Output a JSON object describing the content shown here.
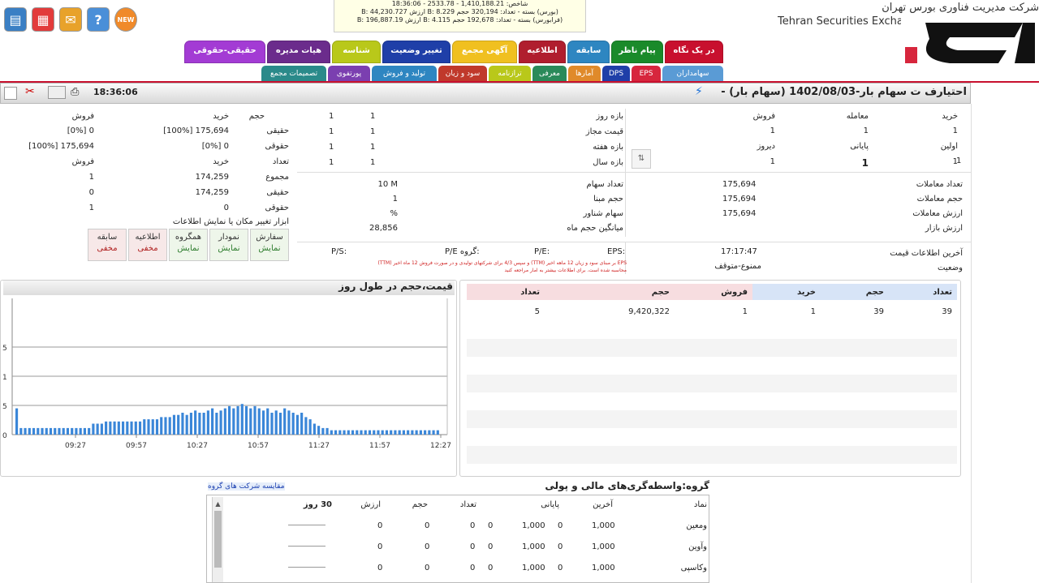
{
  "toolbar_icons": [
    {
      "name": "doc-app-icon",
      "color": "#3a7fc4",
      "glyph": "▤"
    },
    {
      "name": "grid-app-icon",
      "color": "#e23b3b",
      "glyph": "▦"
    },
    {
      "name": "chat-app-icon",
      "color": "#e8a22a",
      "glyph": "✉"
    },
    {
      "name": "help-icon",
      "color": "#4a8fd8",
      "glyph": "?"
    },
    {
      "name": "new-icon",
      "color": "#f08a2a",
      "glyph": "NEW"
    }
  ],
  "ticker": {
    "line1": "شاخص: 1,410,188.21 - 2533.78 - 18:36:06",
    "line2": "(بورس) بسته - تعداد: 320,194 حجم B: 8.229 ارزش B: 44,230.727",
    "line3": "(فرابورس) بسته - تعداد: 192,678 حجم B: 4.115 ارزش B: 196,887.19"
  },
  "header": {
    "fa": "شرکت مدیریت فناوری بورس تهران",
    "en": "Tehran Securities Exchange Technology Management"
  },
  "tabs_top": [
    {
      "label": "در یک نگاه",
      "color": "#c8102e"
    },
    {
      "label": "پیام ناظر",
      "color": "#1a8a2a"
    },
    {
      "label": "سابقه",
      "color": "#2e86c1"
    },
    {
      "label": "اطلاعیه",
      "color": "#b01e2e"
    },
    {
      "label": "آگهی مجمع",
      "color": "#f0c020"
    },
    {
      "label": "تغییر وضعیت",
      "color": "#1f3fa8"
    },
    {
      "label": "شناسه",
      "color": "#b9c81a"
    },
    {
      "label": "هیات مدیره",
      "color": "#6b2c8c"
    },
    {
      "label": "حقیقی-حقوقی",
      "color": "#a33bd4"
    }
  ],
  "tabs_bottom": [
    {
      "label": "سهامداران",
      "color": "#5a9bd5"
    },
    {
      "label": "EPS",
      "color": "#d7263d"
    },
    {
      "label": "DPS",
      "color": "#1f3fa8"
    },
    {
      "label": "آمارها",
      "color": "#e08a2a"
    },
    {
      "label": "معرفی",
      "color": "#2a8a5a"
    },
    {
      "label": "ترازنامه",
      "color": "#b9c81a"
    },
    {
      "label": "سود و زیان",
      "color": "#c0392b"
    },
    {
      "label": "تولید و فروش",
      "color": "#2e86c1"
    },
    {
      "label": "پورتفوی",
      "color": "#7b3fb0"
    },
    {
      "label": "تصمیمات مجمع",
      "color": "#2a8a8a"
    }
  ],
  "title": {
    "text": "احتیارف ت سهام بار-1402/08/03 (سهام بار) -",
    "time": "18:36:06"
  },
  "right_block": {
    "headers": [
      "خرید",
      "معامله",
      "فروش"
    ],
    "rows": [
      {
        "label": "",
        "c1": "1",
        "c2": "1",
        "c3": "1"
      },
      {
        "label": "اولین",
        "c1": "1",
        "c2": "پایانی",
        "c3": "دیروز"
      },
      {
        "label": "",
        "c1": "1",
        "c2": "1",
        "c3": "1"
      }
    ],
    "stats": [
      {
        "label": "تعداد معاملات",
        "value": "175,694"
      },
      {
        "label": "حجم معاملات",
        "value": "175,694"
      },
      {
        "label": "ارزش معاملات",
        "value": "175,694"
      },
      {
        "label": "ارزش بازار",
        "value": ""
      }
    ],
    "last_update_label": "آخرین اطلاعات قیمت",
    "last_update_value": "17:17:47",
    "status_label": "وضعیت",
    "status_value": "ممنوع-متوقف"
  },
  "mid_block": {
    "rows": [
      {
        "label": "بازه روز",
        "a": "1",
        "b": "1"
      },
      {
        "label": "قیمت مجاز",
        "a": "1",
        "b": "1"
      },
      {
        "label": "بازه هفته",
        "a": "1",
        "b": "1"
      },
      {
        "label": "بازه سال",
        "a": "1",
        "b": "1"
      }
    ],
    "stats": [
      {
        "label": "تعداد سهام",
        "value": "10 M"
      },
      {
        "label": "حجم مبنا",
        "value": "1"
      },
      {
        "label": "سهام شناور",
        "value": "%"
      },
      {
        "label": "میانگین حجم ماه",
        "value": "28,856"
      }
    ],
    "ratios": [
      "EPS:",
      "P/E:",
      "P/E گروه:",
      "P/S:"
    ],
    "note1": "EPS بر مبنای سود و زیان 12 ماهه اخیر (TTM) و سپس 4/3 برای شرکتهای تولیدی و در صورت فروش 12 ماه اخیر (TTM)",
    "note2": "محاسبه شده است. برای اطلاعات بیشتر به آمار مراجعه کنید"
  },
  "left_block": {
    "header": {
      "vol": "حجم",
      "buy": "خرید",
      "sell": "فروش"
    },
    "rows": [
      {
        "label": "حقیقی",
        "buy": "[100%] 175,694",
        "sell": "[0%] 0"
      },
      {
        "label": "حقوقی",
        "buy": "[0%] 0",
        "sell": "[100%] 175,694"
      },
      {
        "label": "تعداد",
        "buy": "خرید",
        "sell": "فروش"
      },
      {
        "label": "مجموع",
        "buy": "174,259",
        "sell": "1"
      },
      {
        "label": "حقیقی",
        "buy": "174,259",
        "sell": "0"
      },
      {
        "label": "حقوقی",
        "buy": "0",
        "sell": "1"
      }
    ],
    "tools_caption": "ابزار تغییر مکان یا نمایش اطلاعات",
    "tools": [
      {
        "title": "سفارش",
        "state": "نمایش"
      },
      {
        "title": "نمودار",
        "state": "نمایش"
      },
      {
        "title": "همگروه",
        "state": "نمایش"
      },
      {
        "title": "اطلاعیه",
        "state": "مخفی"
      },
      {
        "title": "سابقه",
        "state": "مخفی"
      }
    ]
  },
  "orderbook": {
    "headers": [
      "تعداد",
      "حجم",
      "خرید",
      "فروش",
      "حجم",
      "تعداد"
    ],
    "row": [
      "39",
      "39",
      "1",
      "1",
      "9,420,322",
      "5"
    ]
  },
  "chart_data": {
    "type": "bar",
    "title": "قیمت،حجم در طول روز",
    "x_ticks": [
      "09:27",
      "09:57",
      "10:27",
      "10:57",
      "11:27",
      "11:57",
      "12:27"
    ],
    "y_ticks": [
      "0",
      "5",
      "1",
      "5"
    ],
    "values": [
      12,
      3,
      3,
      3,
      3,
      3,
      3,
      3,
      3,
      3,
      3,
      3,
      3,
      3,
      3,
      3,
      3,
      3,
      5,
      5,
      5,
      6,
      6,
      6,
      6,
      6,
      6,
      6,
      6,
      6,
      7,
      7,
      7,
      7,
      8,
      8,
      8,
      9,
      9,
      10,
      9,
      10,
      11,
      10,
      10,
      11,
      12,
      10,
      11,
      12,
      13,
      12,
      13,
      14,
      13,
      12,
      13,
      12,
      11,
      12,
      10,
      11,
      10,
      12,
      11,
      10,
      9,
      10,
      8,
      7,
      5,
      4,
      3,
      3,
      2,
      2,
      2,
      2,
      2,
      2,
      2,
      2,
      2,
      2,
      2,
      2,
      2,
      2,
      2,
      2,
      2,
      2,
      2,
      2,
      2,
      2,
      2,
      2,
      2,
      2
    ],
    "bar_color": "#3a86d8"
  },
  "group": {
    "title": "گروه:واسطه‌گری‌های مالی و پولی",
    "link": "مقایسه شرکت های گروه",
    "headers": [
      "نماد",
      "آخرین",
      "پایانی",
      "تعداد",
      "حجم",
      "ارزش",
      "30 روز"
    ],
    "rows": [
      {
        "sym": "ومعین",
        "last": "1,000",
        "last_c": "0",
        "close": "1,000",
        "close_c": "0",
        "count": "0",
        "vol": "0",
        "value": "0"
      },
      {
        "sym": "وآوین",
        "last": "1,000",
        "last_c": "0",
        "close": "1,000",
        "close_c": "0",
        "count": "0",
        "vol": "0",
        "value": "0"
      },
      {
        "sym": "وکاسپی",
        "last": "1,000",
        "last_c": "0",
        "close": "1,000",
        "close_c": "0",
        "count": "0",
        "vol": "0",
        "value": "0"
      }
    ]
  }
}
